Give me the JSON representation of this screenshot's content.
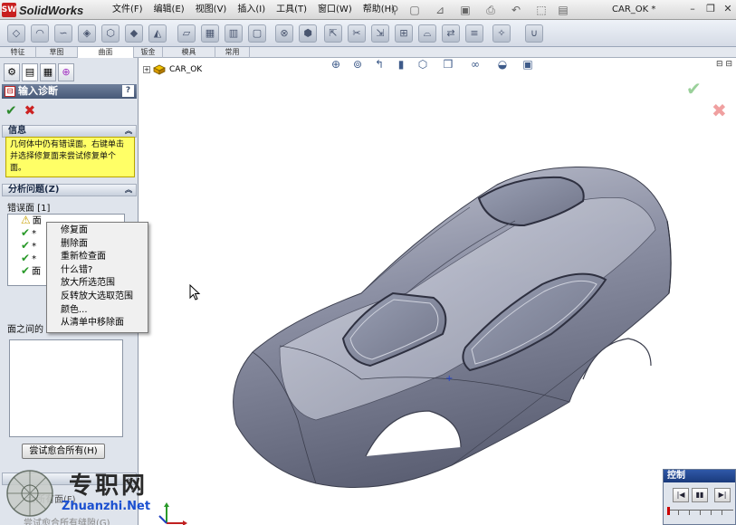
{
  "app": {
    "logo_badge": "SW",
    "name": "SolidWorks",
    "document_title": "CAR_OK *"
  },
  "menu": [
    "文件(F)",
    "编辑(E)",
    "视图(V)",
    "插入(I)",
    "工具(T)",
    "窗口(W)",
    "帮助(H)"
  ],
  "command_tabs": [
    "特征",
    "草图",
    "曲面",
    "钣金",
    "模具",
    "常用"
  ],
  "property_manager": {
    "title": "输入诊断",
    "help": "?",
    "ok": "✔",
    "cancel": "✖",
    "info": {
      "header": "信息",
      "message": "几何体中仍有错误面。右键单击并选择修复面来尝试修复单个面。"
    },
    "analyze": {
      "header": "分析问题(Z)",
      "faulty_faces_label": "错误面 [1]",
      "faces_row_text": [
        "面",
        "*",
        "*",
        "*",
        "面"
      ],
      "gaps_label": "面之间的",
      "heal_all_button": "尝试愈合所有(H)"
    },
    "bottom": {
      "line1": "合所有面(F)",
      "line2": "尝试愈合所有缝隙(G)"
    }
  },
  "context_menu": {
    "items": [
      "修复面",
      "删除面",
      "重新检查面",
      "什么错?",
      "放大所选范围",
      "反转放大选取范围",
      "颜色...",
      "从清单中移除面"
    ]
  },
  "feature_tree": {
    "root": "CAR_OK"
  },
  "watermark": {
    "cn": "专职网",
    "url": "Zhuanzhi.Net"
  },
  "control_panel": {
    "title": "控制"
  },
  "colors": {
    "accent_header": "#485a78",
    "info_yellow": "#ffff66",
    "ok_green": "#2d8a2d",
    "cancel_red": "#cc2222",
    "car_body": "#8a8ea0"
  }
}
